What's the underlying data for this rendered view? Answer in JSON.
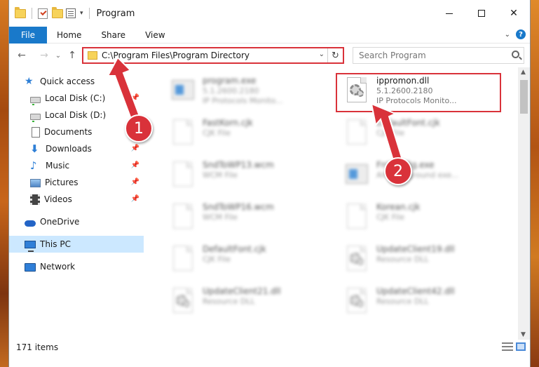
{
  "window": {
    "title": "Program",
    "minimize_label": "Minimize",
    "maximize_label": "Maximize",
    "close_glyph": "✕"
  },
  "ribbon": {
    "tabs": [
      "File",
      "Home",
      "Share",
      "View"
    ],
    "help_glyph": "?"
  },
  "nav": {
    "back_glyph": "←",
    "forward_glyph": "→",
    "recent_glyph": "⌄",
    "up_glyph": "↑",
    "address": "C:\\Program Files\\Program Directory",
    "refresh_glyph": "↻",
    "search_placeholder": "Search Program"
  },
  "sidebar": {
    "quick_access": "Quick access",
    "items": [
      {
        "label": "Local Disk (C:)",
        "pinned": true
      },
      {
        "label": "Local Disk (D:)",
        "pinned": false
      },
      {
        "label": "Documents",
        "pinned": true
      },
      {
        "label": "Downloads",
        "pinned": true
      },
      {
        "label": "Music",
        "pinned": true
      },
      {
        "label": "Pictures",
        "pinned": true
      },
      {
        "label": "Videos",
        "pinned": true
      }
    ],
    "onedrive": "OneDrive",
    "this_pc": "This PC",
    "network": "Network"
  },
  "files": [
    {
      "name": "program.exe",
      "line2": "5.1.2600.2180",
      "line3": "IP Protocols Monito...",
      "kind": "exe-old",
      "blurred": true
    },
    {
      "name": "ippromon.dll",
      "line2": "5.1.2600.2180",
      "line3": "IP Protocols Monito...",
      "kind": "dll",
      "blurred": false
    },
    {
      "name": "FastKorn.cjk",
      "line2": "CJK File",
      "line3": "",
      "kind": "page",
      "blurred": true
    },
    {
      "name": "DefaultFont.cjk",
      "line2": "CJK File",
      "line3": "",
      "kind": "page",
      "blurred": true
    },
    {
      "name": "SndToWP13.wcm",
      "line2": "WCM File",
      "line3": "",
      "kind": "page",
      "blurred": true
    },
    {
      "name": "FnWndBg.exe",
      "line2": "Alt Background exe...",
      "line3": "",
      "kind": "exe",
      "blurred": true
    },
    {
      "name": "SndToWP16.wcm",
      "line2": "WCM File",
      "line3": "",
      "kind": "page",
      "blurred": true
    },
    {
      "name": "Korean.cjk",
      "line2": "CJK File",
      "line3": "",
      "kind": "page",
      "blurred": true
    },
    {
      "name": "DefaultFont.cjk",
      "line2": "CJK File",
      "line3": "",
      "kind": "page",
      "blurred": true
    },
    {
      "name": "UpdateClient19.dll",
      "line2": "Resource DLL",
      "line3": "",
      "kind": "dll",
      "blurred": true
    },
    {
      "name": "UpdateClient21.dll",
      "line2": "Resource DLL",
      "line3": "",
      "kind": "dll",
      "blurred": true
    },
    {
      "name": "UpdateClient42.dll",
      "line2": "Resource DLL",
      "line3": "",
      "kind": "dll",
      "blurred": true
    }
  ],
  "status": {
    "count": "171 items"
  },
  "callouts": [
    "1",
    "2"
  ],
  "colors": {
    "accent": "#1979ca",
    "highlight": "#d9323a",
    "selected_bg": "#cce8ff"
  }
}
